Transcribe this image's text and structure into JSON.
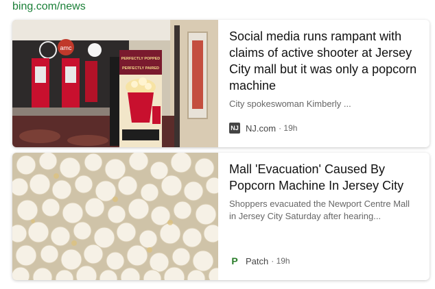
{
  "source": {
    "label": "bing.com/news"
  },
  "articles": [
    {
      "headline": "Social media runs rampant with claims of active shooter at Jersey City mall but it was only a popcorn machine",
      "snippet": "City spokeswoman Kimberly ...",
      "publisher": "NJ.com",
      "publisher_icon": "nj-logo-icon",
      "time": "· 19h",
      "image_alt": "Movie theater lobby with popcorn display"
    },
    {
      "headline": "Mall 'Evacuation' Caused By Popcorn Machine In Jersey City",
      "snippet": "Shoppers evacuated the Newport Centre Mall in Jersey City Saturday after hearing...",
      "publisher": "Patch",
      "publisher_icon": "patch-logo-icon",
      "time": "· 19h",
      "image_alt": "Close-up of popcorn"
    }
  ],
  "thumb_text": {
    "poster_top": "PERFECTLY POPPED",
    "poster_bottom": "PERFECTLY PAIRED",
    "amc": "amc"
  },
  "colors": {
    "source_link": "#1a7f37",
    "headline": "#111111",
    "snippet": "#666666",
    "patch_green": "#2a7d2a"
  }
}
